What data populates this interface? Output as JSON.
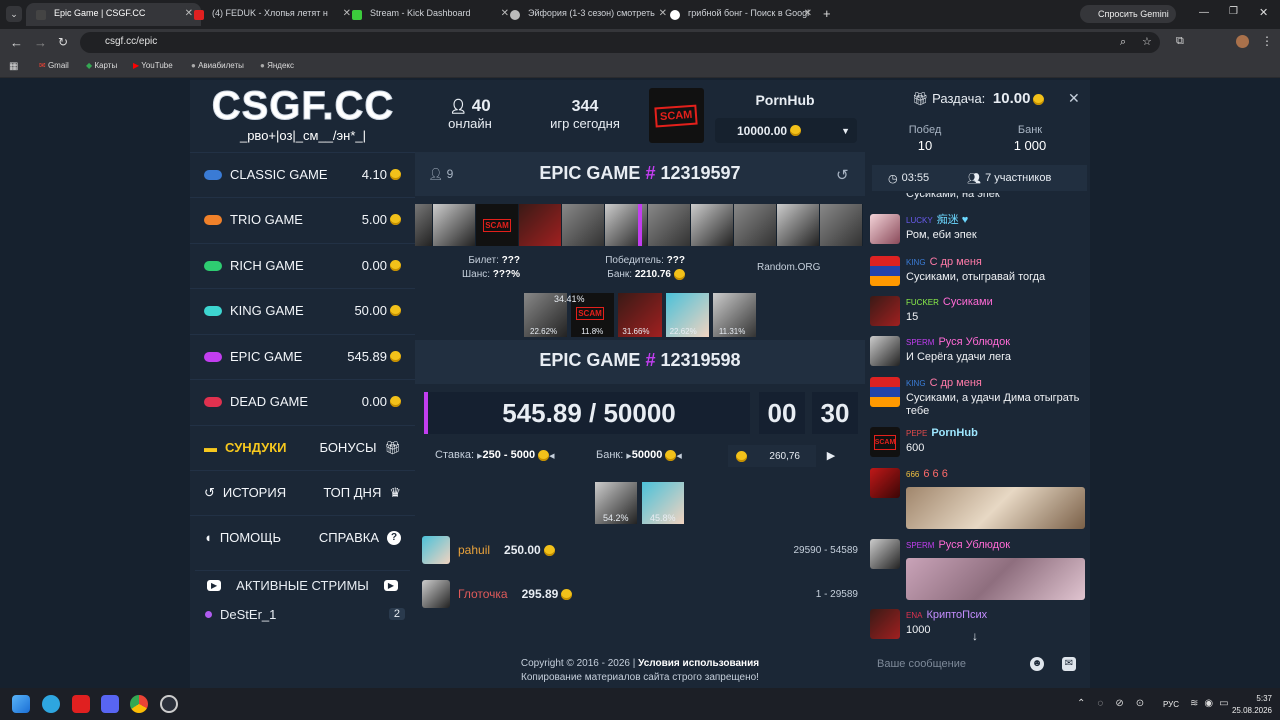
{
  "browser": {
    "tabs": [
      {
        "title": "Epic Game | CSGF.CC"
      },
      {
        "title": "(4) FEDUK - Хлопья летят н"
      },
      {
        "title": "Stream - Kick Dashboard"
      },
      {
        "title": "Эйфория (1-3 сезон) смотреть"
      },
      {
        "title": "грибной бонг - Поиск в Googl"
      }
    ],
    "url": "csgf.cc/epic",
    "gemini": "Спросить Gemini",
    "bookmarks": [
      "Gmail",
      "Карты",
      "YouTube",
      "Авиабилеты",
      "Яндекс"
    ]
  },
  "logo": {
    "title": "CSGF.CC",
    "subtitle": "_рво+|оз|_см__/эн*_|"
  },
  "stats": {
    "online": "40",
    "online_label": "онлайн",
    "games": "344",
    "games_label": "игр сегодня"
  },
  "top_user": {
    "name": "PornHub",
    "amount": "10000.00",
    "avatar_text": "SCAM"
  },
  "menu": [
    {
      "label": "CLASSIC GAME",
      "value": "4.10",
      "color": "#3a7bd5"
    },
    {
      "label": "TRIO GAME",
      "value": "5.00",
      "color": "#f0812a"
    },
    {
      "label": "RICH GAME",
      "value": "0.00",
      "color": "#2ecc71"
    },
    {
      "label": "KING GAME",
      "value": "50.00",
      "color": "#3dd5d0"
    },
    {
      "label": "EPIC GAME",
      "value": "545.89",
      "color": "#c23ef0"
    },
    {
      "label": "DEAD GAME",
      "value": "0.00",
      "color": "#e0314f"
    }
  ],
  "extra_menu": {
    "chests": "СУНДУКИ",
    "bonuses": "БОНУСЫ",
    "history": "ИСТОРИЯ",
    "top_day": "ТОП ДНЯ",
    "help": "ПОМОЩЬ",
    "reference": "СПРАВКА"
  },
  "streams": {
    "title": "АКТИВНЫЕ СТРИМЫ",
    "items": [
      {
        "name": "DeStEr_1",
        "count": "2"
      }
    ]
  },
  "prev_game": {
    "players": "9",
    "title": "EPIC GAME",
    "hash": "#",
    "number": "12319597",
    "ticket_label": "Билет:",
    "ticket": "???",
    "chance_label": "Шанс:",
    "chance": "???%",
    "winner_label": "Победитель:",
    "winner": "???",
    "bank_label": "Банк:",
    "bank": "2210.76",
    "random": "Random.ORG",
    "percents": [
      "34.41%",
      "22.62%",
      "11.8%",
      "31.66%",
      "22.62%",
      "11.31%"
    ]
  },
  "cur_game": {
    "title": "EPIC GAME",
    "hash": "#",
    "number": "12319598",
    "amount": "545.89 / 50000",
    "min": "00",
    "sec": "30",
    "bet_label": "Ставка:",
    "bet": "250 - 5000",
    "bank_label": "Банк:",
    "bank": "50000",
    "input_val": "260,76",
    "percents": [
      "54.2%",
      "45.8%"
    ]
  },
  "bets": [
    {
      "name": "pahuil",
      "amount": "250.00",
      "range": "29590 - 54589",
      "color": "#e9a23b"
    },
    {
      "name": "Глоточка",
      "amount": "295.89",
      "range": "1 - 29589",
      "color": "#e05a5a"
    }
  ],
  "footer": {
    "copyright": "Copyright © 2016 - 2026 |",
    "terms": "Условия использования",
    "notice": "Копирование материалов сайта строго запрещено!"
  },
  "giveaway": {
    "label": "Раздача:",
    "amount": "10.00",
    "wins_label": "Побед",
    "wins": "10",
    "bank_label": "Банк",
    "bank": "1 000",
    "time": "03:55",
    "participants": "7 участников"
  },
  "chat": [
    {
      "rank": "",
      "name": "Сусиками, на эпек",
      "text": "",
      "color": "#f0f2f5"
    },
    {
      "rank": "LUCKY",
      "name": "痴迷 ♥",
      "text": "Ром, еби эпек",
      "color": "#6cd8ff"
    },
    {
      "rank": "KING",
      "name": "С др меня",
      "text": "Сусиками, отыгравай тогда",
      "color": "#ff7aa8"
    },
    {
      "rank": "FUCKER",
      "name": "Сусиками",
      "text": "15",
      "color": "#ff6ad5"
    },
    {
      "rank": "SPERM",
      "name": "Руся Ублюдок",
      "text": "И Серёга удачи лега",
      "color": "#ff6ad5"
    },
    {
      "rank": "KING",
      "name": "С др меня",
      "text": "Сусиками, а удачи Дима отыграть тебе",
      "color": "#ff7aa8"
    },
    {
      "rank": "PEPE",
      "name": "PornHub",
      "text": "600",
      "color": "#9ee7ff"
    },
    {
      "rank": "666",
      "name": "6 6 6",
      "text": "",
      "color": "#ff6a6a"
    },
    {
      "rank": "SPERM",
      "name": "Руся Ублюдок",
      "text": "",
      "color": "#ff6ad5"
    },
    {
      "rank": "ENA",
      "name": "КриптоПсих",
      "text": "1000",
      "color": "#c58dff"
    }
  ],
  "chat_input": {
    "placeholder": "Ваше сообщение"
  },
  "taskbar": {
    "lang": "РУС",
    "time": "5:37",
    "date": "25.08.2026"
  }
}
